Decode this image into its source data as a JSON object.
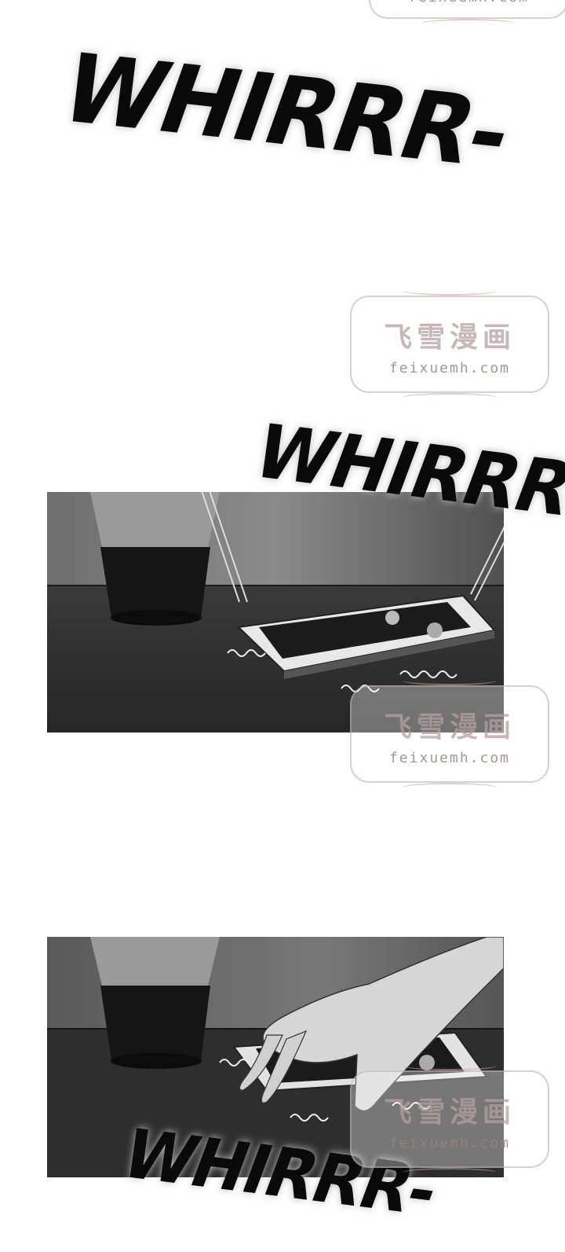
{
  "sound_effects": {
    "top": "WHIRRR-",
    "middle": "WHIRRR-",
    "bottom": "WHIRRR-"
  },
  "watermark": {
    "title": "飞雪漫画",
    "url": "feixuemh.com"
  }
}
